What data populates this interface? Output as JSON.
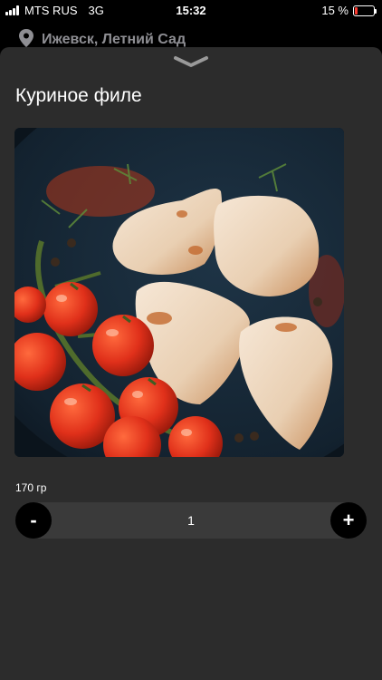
{
  "status_bar": {
    "carrier": "MTS RUS",
    "network": "3G",
    "time": "15:32",
    "battery": "15 %",
    "battery_level": 0.15,
    "battery_color": "#ff3b30"
  },
  "location": {
    "icon": "location-pin-icon",
    "text": "Ижевск, Летний Сад"
  },
  "product": {
    "title": "Куриное филе",
    "weight": "170 гр",
    "image_icon": "chicken-fillet-photo"
  },
  "quantity": {
    "minus_label": "-",
    "value": "1",
    "plus_label": "+"
  },
  "colors": {
    "sheet_bg": "#2c2c2c",
    "stepper_track": "#3a3a3a",
    "button_bg": "#000000"
  }
}
